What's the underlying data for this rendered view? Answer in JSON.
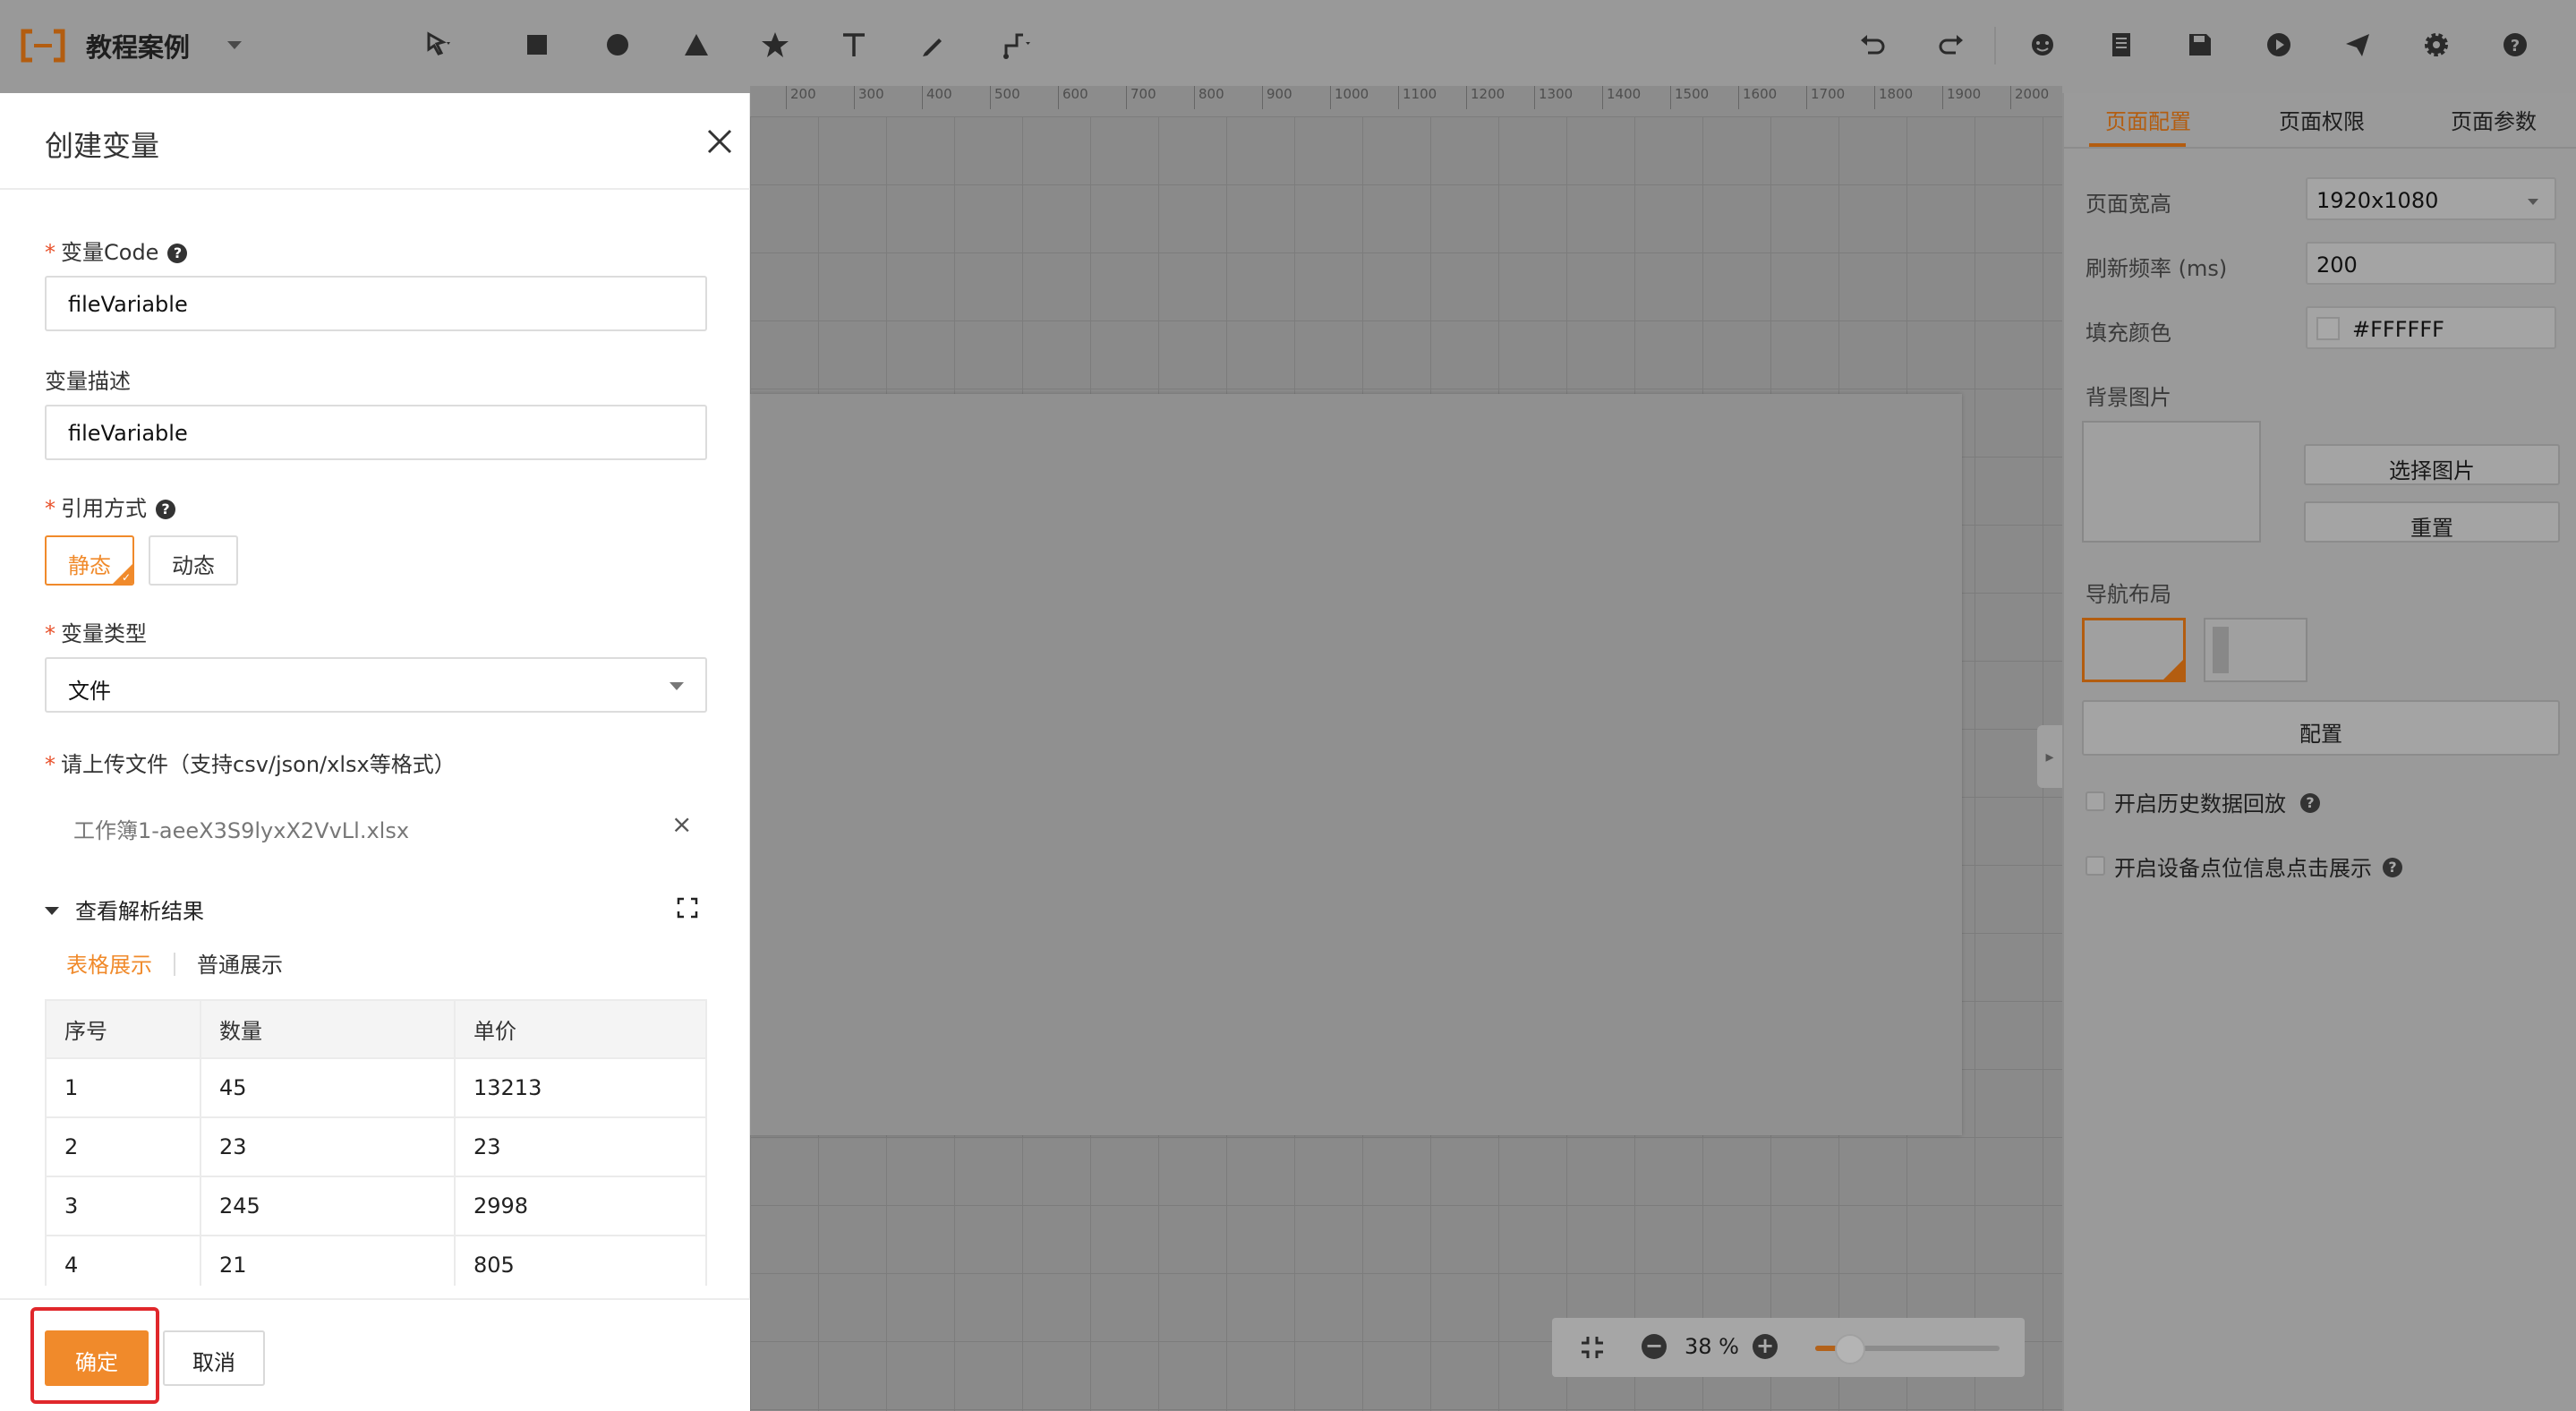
{
  "app": {
    "title": "教程案例"
  },
  "toolbar": {
    "tools": [
      "select-tool-icon",
      "rectangle-icon",
      "circle-icon",
      "triangle-icon",
      "star-icon",
      "text-icon",
      "pen-icon",
      "connector-icon"
    ],
    "actions": [
      "undo-icon",
      "redo-icon",
      "emoji-icon",
      "document-icon",
      "save-icon",
      "play-icon",
      "send-icon",
      "settings-icon",
      "help-icon"
    ]
  },
  "ruler": {
    "ticks": [
      "200",
      "300",
      "400",
      "500",
      "600",
      "700",
      "800",
      "900",
      "1000",
      "1100",
      "1200",
      "1300",
      "1400",
      "1500",
      "1600",
      "1700",
      "1800",
      "1900",
      "2000"
    ]
  },
  "zoom": {
    "value": "38 %",
    "level": 0.15
  },
  "right_panel": {
    "tabs": [
      "页面配置",
      "页面权限",
      "页面参数"
    ],
    "active_tab": 0,
    "page_size_label": "页面宽高",
    "page_size_value": "1920x1080",
    "refresh_label": "刷新频率 (ms)",
    "refresh_value": "200",
    "fill_label": "填充颜色",
    "fill_value": "#FFFFFF",
    "bg_label": "背景图片",
    "select_image_button": "选择图片",
    "reset_button": "重置",
    "nav_label": "导航布局",
    "config_button": "配置",
    "history_label": "开启历史数据回放",
    "device_label": "开启设备点位信息点击展示"
  },
  "drawer": {
    "title": "创建变量",
    "code_label": "变量Code",
    "code_value": "fileVariable",
    "desc_label": "变量描述",
    "desc_value": "fileVariable",
    "ref_label": "引用方式",
    "ref_options": [
      "静态",
      "动态"
    ],
    "ref_selected": 0,
    "type_label": "变量类型",
    "type_value": "文件",
    "upload_label": "请上传文件（支持csv/json/xlsx等格式）",
    "file_name": "工作簿1-aeeX3S9lyxX2VvLl.xlsx",
    "result_title": "查看解析结果",
    "view_tabs": [
      "表格展示",
      "普通展示"
    ],
    "view_selected": 0,
    "table": {
      "columns": [
        "序号",
        "数量",
        "单价"
      ],
      "rows": [
        [
          "1",
          "45",
          "13213"
        ],
        [
          "2",
          "23",
          "23"
        ],
        [
          "3",
          "245",
          "2998"
        ],
        [
          "4",
          "21",
          "805"
        ]
      ]
    },
    "ok_button": "确定",
    "cancel_button": "取消"
  },
  "colors": {
    "accent": "#f08a2b",
    "required": "#e8512b",
    "highlight": "#e0272b"
  }
}
